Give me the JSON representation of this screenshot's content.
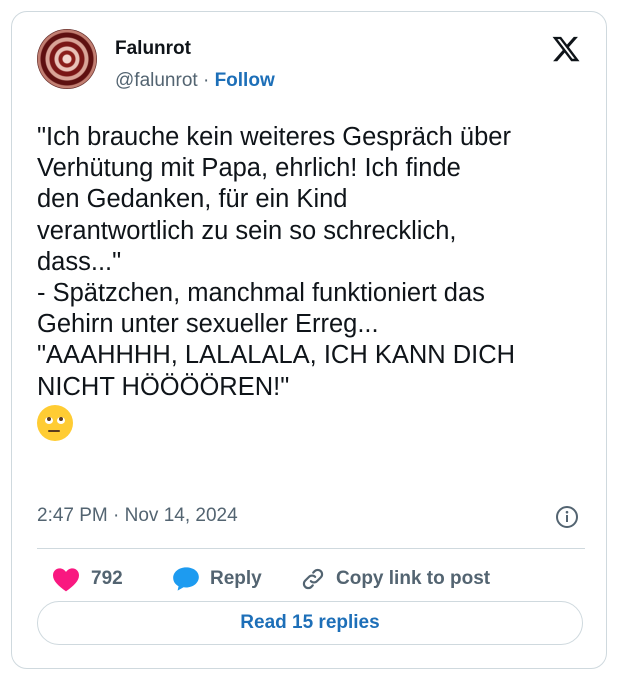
{
  "author": {
    "name": "Falunrot",
    "handle": "@falunrot",
    "separator": "·",
    "follow_label": "Follow"
  },
  "logo_icon": "x-logo-icon",
  "tweet": {
    "lines": [
      "\"Ich brauche kein weiteres Gespräch über",
      "Verhütung mit Papa, ehrlich! Ich finde",
      "den Gedanken, für ein Kind",
      "verantwortlich zu sein so schrecklich,",
      "dass...\"",
      "- Spätzchen, manchmal funktioniert das",
      "Gehirn unter sexueller Erreg...",
      "\"AAAHHHH, LALALALA, ICH KANN DICH",
      "NICHT HÖÖÖÖREN!\""
    ],
    "emoji": "face-with-rolling-eyes-emoji",
    "timestamp": "2:47 PM · Nov 14, 2024"
  },
  "actions": {
    "likes": "792",
    "reply_label": "Reply",
    "copy_label": "Copy link to post"
  },
  "read_replies_label": "Read 15 replies",
  "colors": {
    "heart": "#f91880",
    "reply_bubble": "#1d9bf0",
    "link_blue": "#1d6fb8",
    "secondary_text": "#536471",
    "border": "#cfd9de"
  }
}
